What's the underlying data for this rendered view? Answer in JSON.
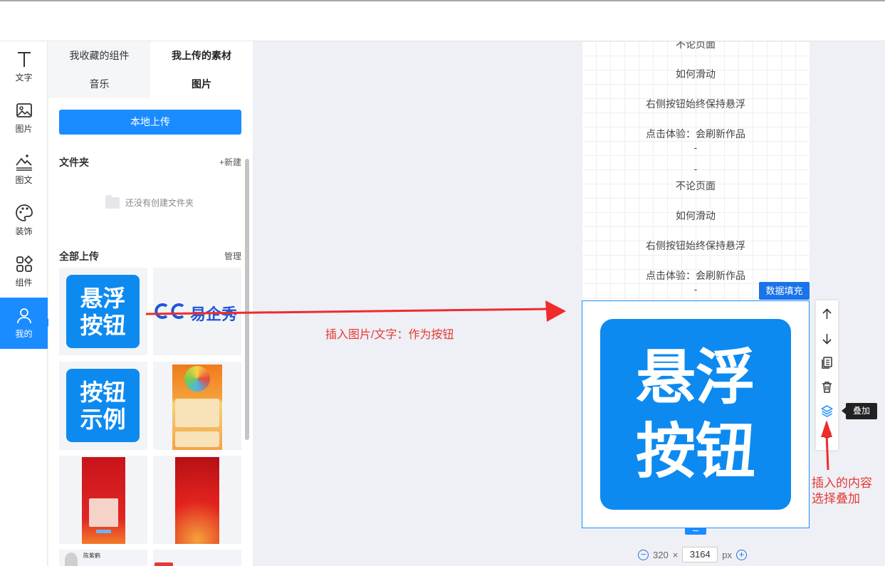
{
  "nav": [
    {
      "label": "文字",
      "icon": "text-icon"
    },
    {
      "label": "图片",
      "icon": "image-icon"
    },
    {
      "label": "图文",
      "icon": "image-text-icon"
    },
    {
      "label": "装饰",
      "icon": "palette-icon"
    },
    {
      "label": "组件",
      "icon": "components-icon"
    },
    {
      "label": "我的",
      "icon": "user-icon",
      "active": true
    }
  ],
  "tabs": {
    "favorites": "我收藏的组件",
    "uploads": "我上传的素材",
    "music": "音乐",
    "images": "图片"
  },
  "upload_button": "本地上传",
  "folders": {
    "title": "文件夹",
    "new_link": "+新建",
    "empty_text": "还没有创建文件夹"
  },
  "all_uploads": {
    "title": "全部上传",
    "manage_link": "管理"
  },
  "thumbs": {
    "tile1_line1": "悬浮",
    "tile1_line2": "按钮",
    "logo_text": "易企秀",
    "tile2_line1": "按钮",
    "tile2_line2": "示例",
    "profile_name": "陈紫鹤"
  },
  "page_texts": [
    "不论页面",
    "如何滑动",
    "右侧按钮始终保持悬浮",
    "点击体验：会刷新作品",
    "-",
    "-",
    "不论页面",
    "如何滑动",
    "右侧按钮始终保持悬浮",
    "点击体验：会刷新作品",
    "-"
  ],
  "selected": {
    "tag": "数据填充",
    "line1": "悬浮",
    "line2": "按钮"
  },
  "tooltip": "叠加",
  "size": {
    "width": "320",
    "times": "×",
    "height": "3164",
    "unit": "px"
  },
  "annotations": {
    "arrow_label": "插入图片/文字：作为按钮",
    "note_line1": "插入的内容",
    "note_line2": "选择叠加"
  },
  "colors": {
    "primary": "#1a8cff",
    "annotation": "#e53935"
  }
}
